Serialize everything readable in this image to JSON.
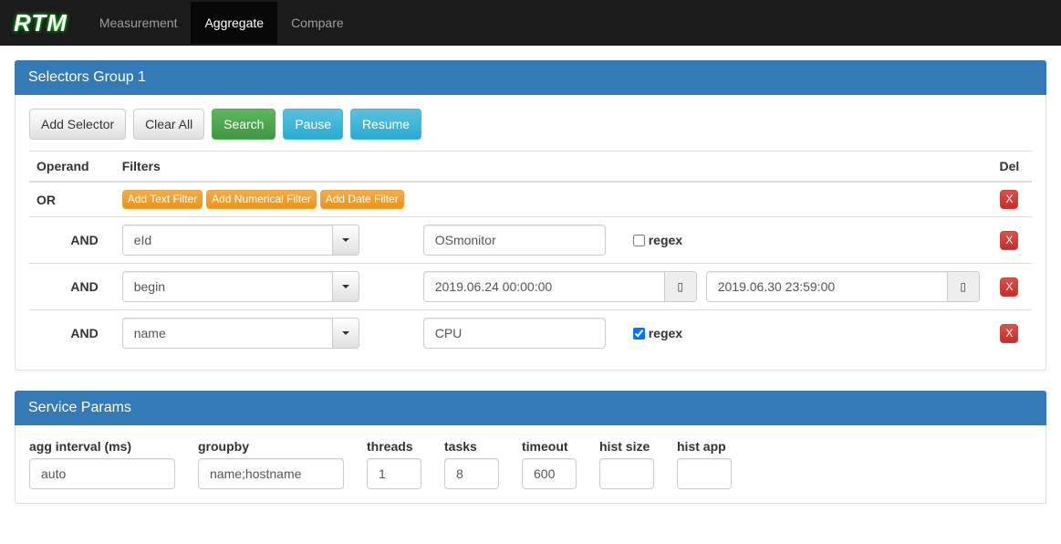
{
  "brand": "RTM",
  "nav": {
    "items": [
      "Measurement",
      "Aggregate",
      "Compare"
    ],
    "active_index": 1
  },
  "selectors_panel": {
    "title": "Selectors Group 1",
    "buttons": {
      "add_selector": "Add Selector",
      "clear_all": "Clear All",
      "search": "Search",
      "pause": "Pause",
      "resume": "Resume"
    },
    "headers": {
      "operand": "Operand",
      "filters": "Filters",
      "del": "Del"
    },
    "or_label": "OR",
    "and_label": "AND",
    "filter_buttons": {
      "text": "Add Text Filter",
      "numerical": "Add Numerical Filter",
      "date": "Add Date Filter"
    },
    "regex_label": "regex",
    "del_symbol": "X",
    "rows": [
      {
        "type": "text",
        "field": "eId",
        "value": "OSmonitor",
        "regex": false
      },
      {
        "type": "date",
        "field": "begin",
        "from": "2019.06.24 00:00:00",
        "to": "2019.06.30 23:59:00"
      },
      {
        "type": "text",
        "field": "name",
        "value": "CPU",
        "regex": true
      }
    ]
  },
  "service_params": {
    "title": "Service Params",
    "fields": {
      "agg_interval": {
        "label": "agg interval (ms)",
        "value": "auto"
      },
      "groupby": {
        "label": "groupby",
        "value": "name;hostname"
      },
      "threads": {
        "label": "threads",
        "value": "1"
      },
      "tasks": {
        "label": "tasks",
        "value": "8"
      },
      "timeout": {
        "label": "timeout",
        "value": "600"
      },
      "hist_size": {
        "label": "hist size",
        "value": ""
      },
      "hist_app": {
        "label": "hist app",
        "value": ""
      }
    }
  }
}
